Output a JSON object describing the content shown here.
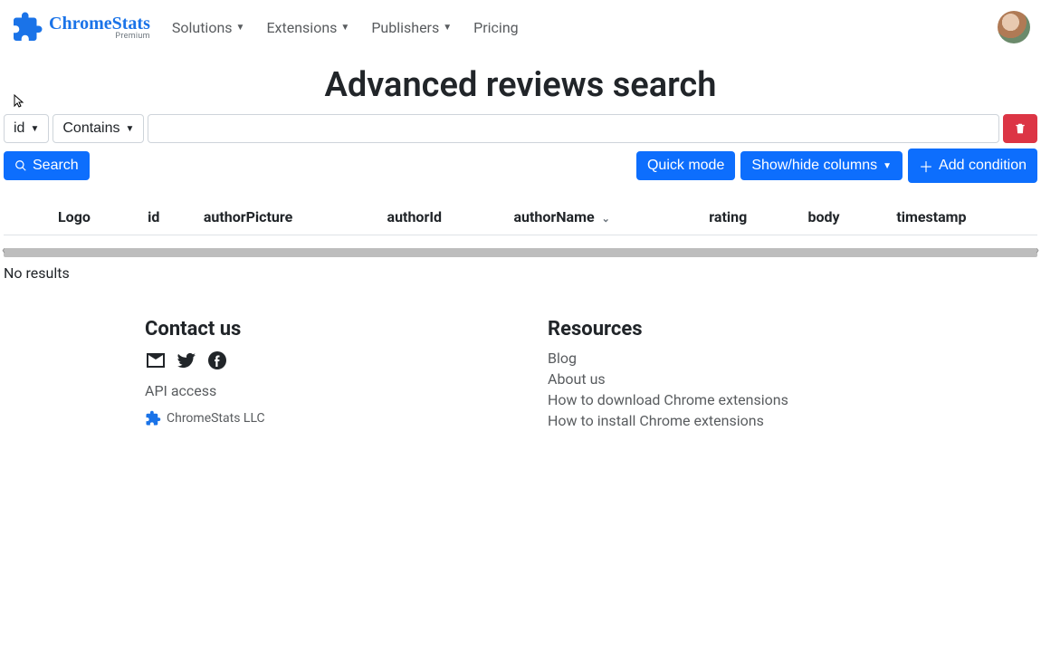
{
  "brand": {
    "name": "ChromeStats",
    "sub": "Premium"
  },
  "nav": {
    "items": [
      {
        "label": "Solutions",
        "dropdown": true
      },
      {
        "label": "Extensions",
        "dropdown": true
      },
      {
        "label": "Publishers",
        "dropdown": true
      },
      {
        "label": "Pricing",
        "dropdown": false
      }
    ]
  },
  "page_title": "Advanced reviews search",
  "condition": {
    "field": "id",
    "operator": "Contains",
    "value": ""
  },
  "buttons": {
    "search": "Search",
    "quick_mode": "Quick mode",
    "show_hide": "Show/hide columns",
    "add_condition": "Add condition"
  },
  "columns": [
    "Logo",
    "id",
    "authorPicture",
    "authorId",
    "authorName",
    "rating",
    "body",
    "timestamp"
  ],
  "sorted_column": "authorName",
  "results_text": "No results",
  "footer": {
    "contact_heading": "Contact us",
    "api_link": "API access",
    "llc": "ChromeStats LLC",
    "resources_heading": "Resources",
    "resources": [
      "Blog",
      "About us",
      "How to download Chrome extensions",
      "How to install Chrome extensions"
    ]
  }
}
